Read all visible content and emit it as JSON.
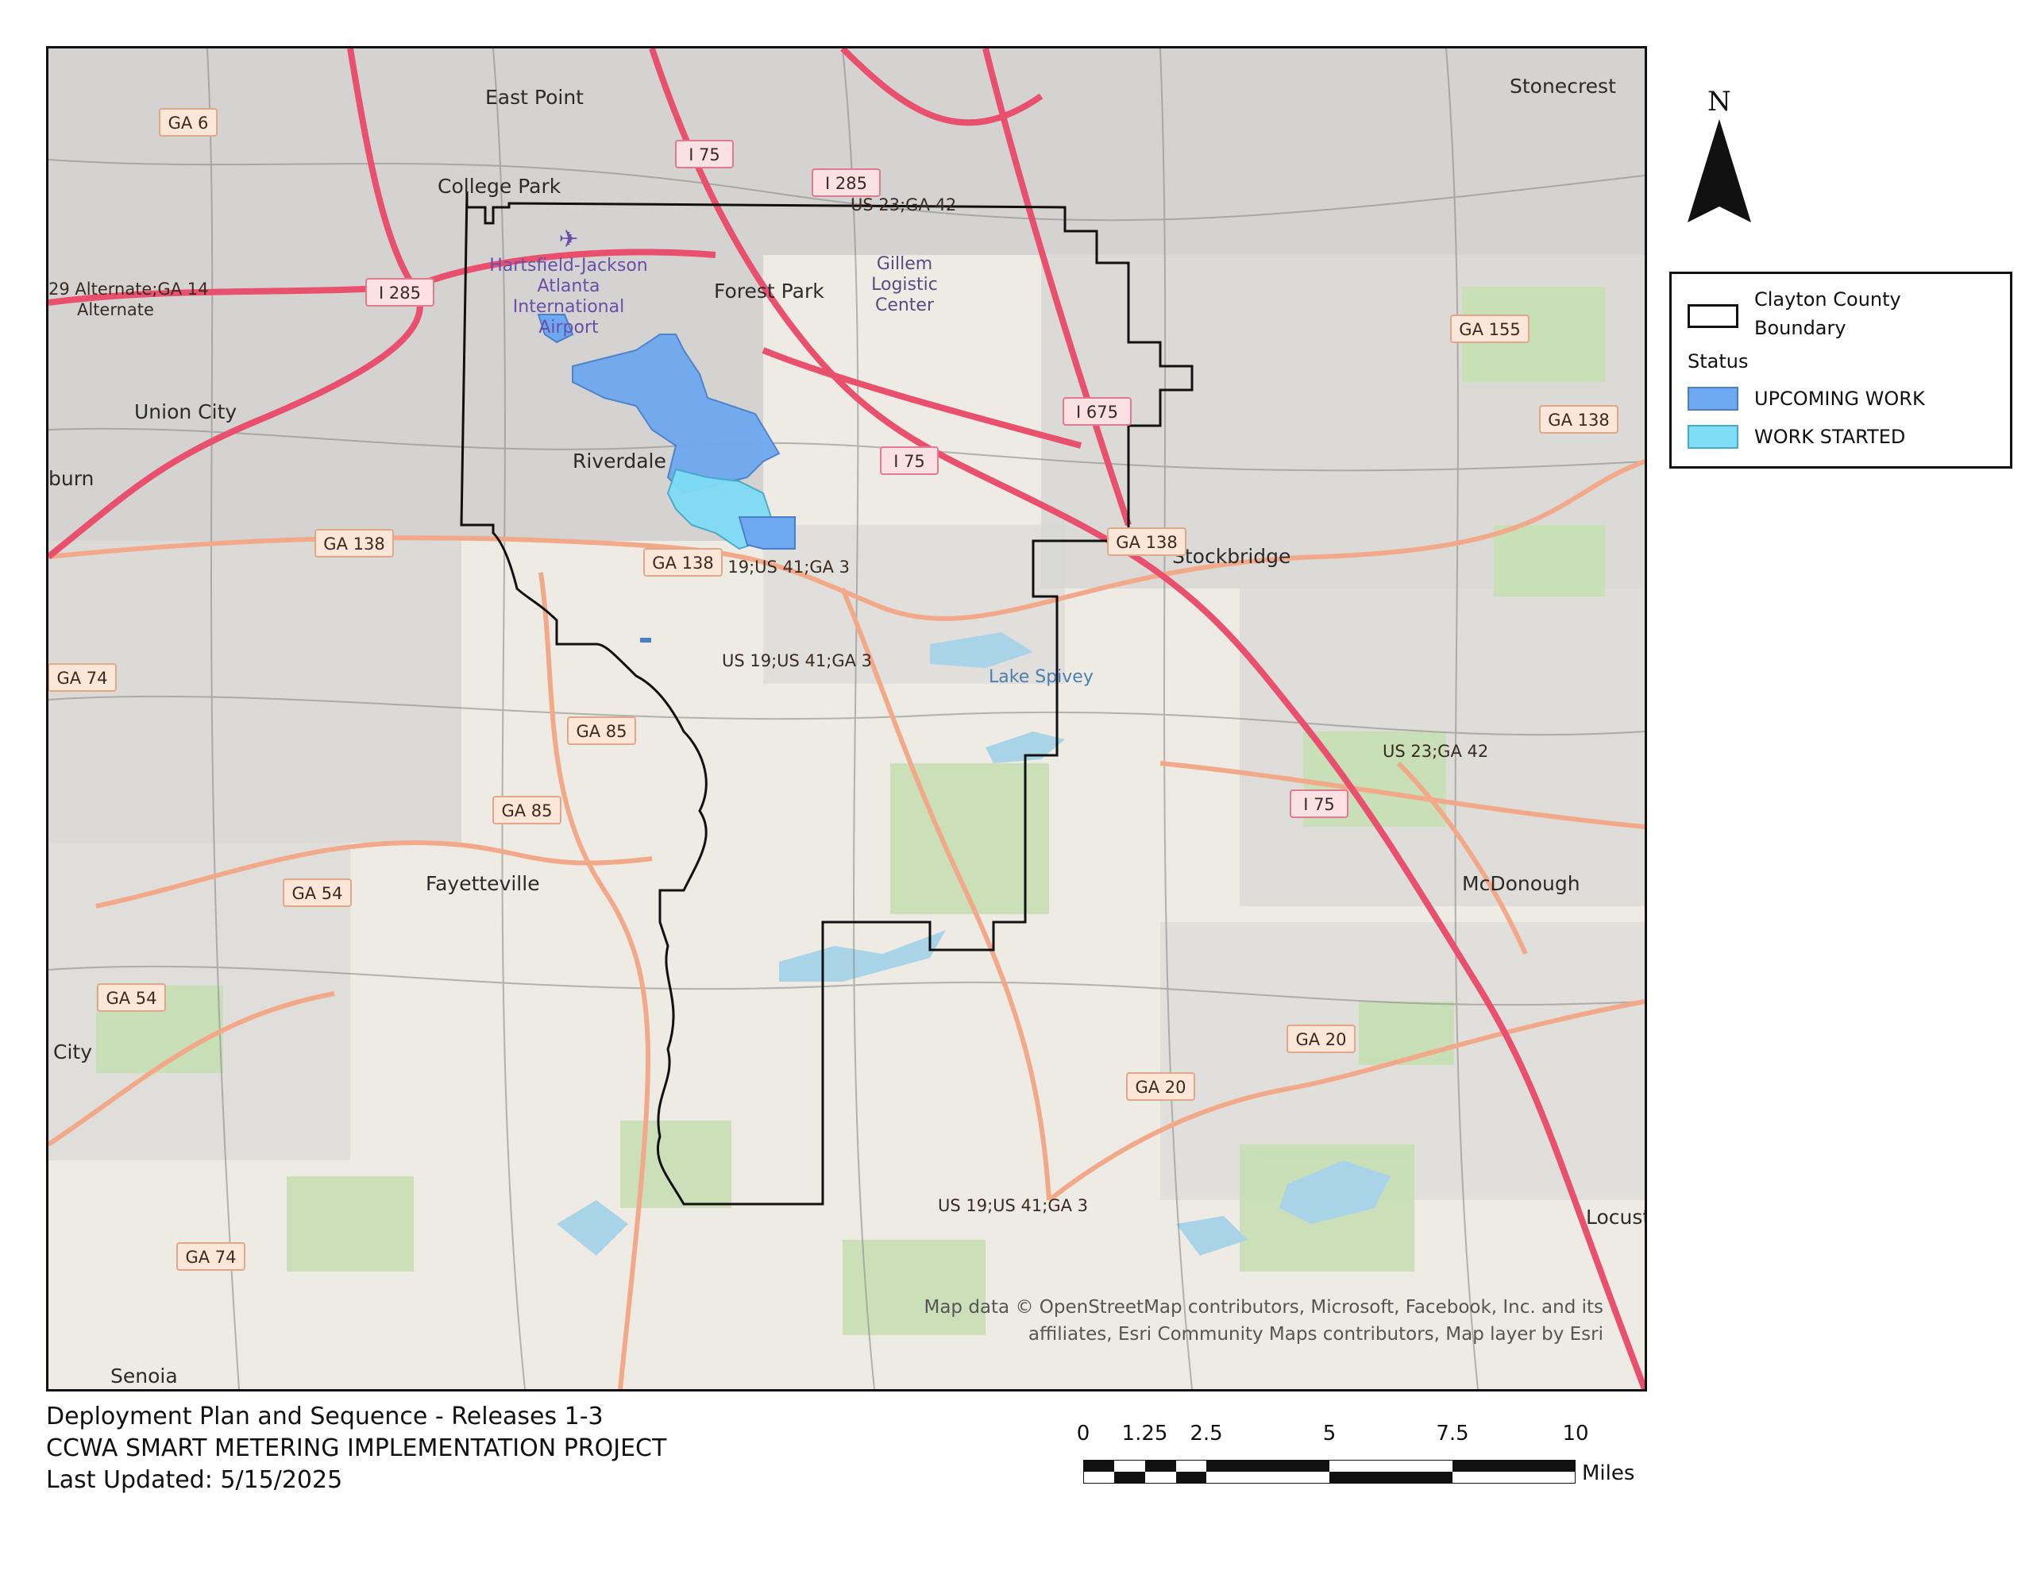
{
  "map": {
    "places": [
      {
        "name": "East Point"
      },
      {
        "name": "College Park"
      },
      {
        "name": "Forest Park"
      },
      {
        "name": "Riverdale"
      },
      {
        "name": "Union City"
      },
      {
        "name": "Stonecrest"
      },
      {
        "name": "Stockbridge"
      },
      {
        "name": "McDonough"
      },
      {
        "name": "Fayetteville"
      },
      {
        "name": "Senoia"
      },
      {
        "name": "City"
      },
      {
        "name": "burn"
      },
      {
        "name": "Locust"
      }
    ],
    "airport_label": [
      "Hartsfield-Jackson",
      "Atlanta",
      "International",
      "Airport"
    ],
    "logistic_label": [
      "Gillem",
      "Logistic",
      "Center"
    ],
    "lake_label": "Lake Spivey",
    "road_labels": [
      "US 23;GA 42",
      "US 19;US 41;GA 3",
      "US 19;US 41;GA 3",
      "US 23;GA 42",
      "US 19;US 41;GA 3",
      "29 Alternate;GA 14",
      "Alternate"
    ],
    "shields": [
      {
        "label": "GA 6",
        "kind": "state"
      },
      {
        "label": "I 75",
        "kind": "interstate"
      },
      {
        "label": "I 285",
        "kind": "interstate"
      },
      {
        "label": "I 285",
        "kind": "interstate"
      },
      {
        "label": "I 675",
        "kind": "interstate"
      },
      {
        "label": "I 75",
        "kind": "interstate"
      },
      {
        "label": "GA 155",
        "kind": "state"
      },
      {
        "label": "GA 138",
        "kind": "state"
      },
      {
        "label": "GA 138",
        "kind": "state"
      },
      {
        "label": "GA 138",
        "kind": "state"
      },
      {
        "label": "GA 138",
        "kind": "state"
      },
      {
        "label": "GA 74",
        "kind": "state"
      },
      {
        "label": "GA 85",
        "kind": "state"
      },
      {
        "label": "GA 85",
        "kind": "state"
      },
      {
        "label": "GA 54",
        "kind": "state"
      },
      {
        "label": "GA 54",
        "kind": "state"
      },
      {
        "label": "I 75",
        "kind": "interstate"
      },
      {
        "label": "GA 20",
        "kind": "state"
      },
      {
        "label": "GA 20",
        "kind": "state"
      },
      {
        "label": "GA 74",
        "kind": "state"
      }
    ],
    "attribution": [
      "Map data © OpenStreetMap contributors, Microsoft, Facebook, Inc. and its",
      "affiliates, Esri Community Maps contributors, Map layer by Esri"
    ],
    "colors": {
      "boundary": "#111111",
      "upcoming": "#6ea8f0",
      "started": "#7fdcf5",
      "interstate": "#e8506e",
      "state_road": "#f2a98a",
      "water": "#a9d3e6",
      "park": "#c9e3b4",
      "urban": "#c9c9c9"
    }
  },
  "north_arrow": {
    "label": "N"
  },
  "legend": {
    "boundary_label_1": "Clayton County",
    "boundary_label_2": "Boundary",
    "status_heading": "Status",
    "items": [
      {
        "label": "UPCOMING WORK",
        "color": "#6ea8f0"
      },
      {
        "label": "WORK STARTED",
        "color": "#7fdcf5"
      }
    ]
  },
  "footer": {
    "line1": "Deployment Plan and Sequence - Releases 1-3",
    "line2": "CCWA SMART METERING IMPLEMENTATION PROJECT",
    "line3": "Last Updated: 5/15/2025"
  },
  "scale": {
    "ticks": [
      "0",
      "1.25",
      "2.5",
      "5",
      "7.5",
      "10"
    ],
    "tick_values": [
      0,
      1.25,
      2.5,
      5,
      7.5,
      10
    ],
    "units": "Miles"
  }
}
